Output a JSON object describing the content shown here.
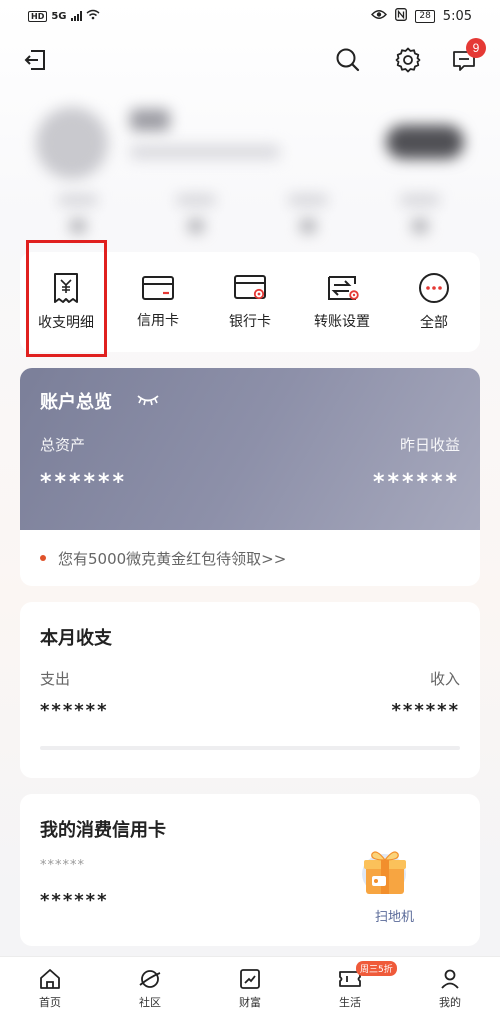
{
  "status_bar": {
    "hd": "HD",
    "network": "5G",
    "battery": "28",
    "time": "5:05"
  },
  "top_nav": {
    "message_count": "9"
  },
  "shortcuts": [
    {
      "label": "收支明细",
      "icon": "receipt-icon"
    },
    {
      "label": "信用卡",
      "icon": "credit-card-icon"
    },
    {
      "label": "银行卡",
      "icon": "bank-card-icon"
    },
    {
      "label": "转账设置",
      "icon": "transfer-icon"
    },
    {
      "label": "全部",
      "icon": "more-icon"
    }
  ],
  "overview": {
    "title": "账户总览",
    "total_assets_label": "总资产",
    "yesterday_label": "昨日收益",
    "total_assets_value": "******",
    "yesterday_value": "******"
  },
  "promo": {
    "text": "您有5000微克黄金红包待领取>>"
  },
  "monthly": {
    "title": "本月收支",
    "expense_label": "支出",
    "income_label": "收入",
    "expense_value": "******",
    "income_value": "******"
  },
  "credit": {
    "title": "我的消费信用卡",
    "small_mask": "******",
    "big_mask": "******",
    "gift_label": "扫地机"
  },
  "tabbar": {
    "items": [
      {
        "label": "首页"
      },
      {
        "label": "社区"
      },
      {
        "label": "财富"
      },
      {
        "label": "生活",
        "badge": "周三5折"
      },
      {
        "label": "我的"
      }
    ]
  },
  "colors": {
    "accent_red": "#e0201f",
    "overview_bg": "#8d90a9",
    "gift_orange": "#f7a541"
  }
}
